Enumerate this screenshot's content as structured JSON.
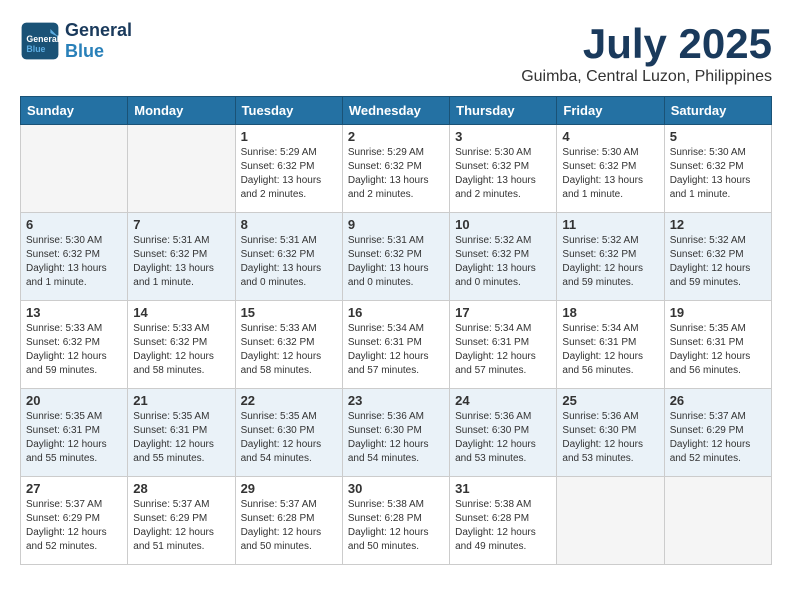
{
  "header": {
    "logo_line1": "General",
    "logo_line2": "Blue",
    "month_year": "July 2025",
    "location": "Guimba, Central Luzon, Philippines"
  },
  "weekdays": [
    "Sunday",
    "Monday",
    "Tuesday",
    "Wednesday",
    "Thursday",
    "Friday",
    "Saturday"
  ],
  "weeks": [
    [
      {
        "day": "",
        "info": ""
      },
      {
        "day": "",
        "info": ""
      },
      {
        "day": "1",
        "info": "Sunrise: 5:29 AM\nSunset: 6:32 PM\nDaylight: 13 hours\nand 2 minutes."
      },
      {
        "day": "2",
        "info": "Sunrise: 5:29 AM\nSunset: 6:32 PM\nDaylight: 13 hours\nand 2 minutes."
      },
      {
        "day": "3",
        "info": "Sunrise: 5:30 AM\nSunset: 6:32 PM\nDaylight: 13 hours\nand 2 minutes."
      },
      {
        "day": "4",
        "info": "Sunrise: 5:30 AM\nSunset: 6:32 PM\nDaylight: 13 hours\nand 1 minute."
      },
      {
        "day": "5",
        "info": "Sunrise: 5:30 AM\nSunset: 6:32 PM\nDaylight: 13 hours\nand 1 minute."
      }
    ],
    [
      {
        "day": "6",
        "info": "Sunrise: 5:30 AM\nSunset: 6:32 PM\nDaylight: 13 hours\nand 1 minute."
      },
      {
        "day": "7",
        "info": "Sunrise: 5:31 AM\nSunset: 6:32 PM\nDaylight: 13 hours\nand 1 minute."
      },
      {
        "day": "8",
        "info": "Sunrise: 5:31 AM\nSunset: 6:32 PM\nDaylight: 13 hours\nand 0 minutes."
      },
      {
        "day": "9",
        "info": "Sunrise: 5:31 AM\nSunset: 6:32 PM\nDaylight: 13 hours\nand 0 minutes."
      },
      {
        "day": "10",
        "info": "Sunrise: 5:32 AM\nSunset: 6:32 PM\nDaylight: 13 hours\nand 0 minutes."
      },
      {
        "day": "11",
        "info": "Sunrise: 5:32 AM\nSunset: 6:32 PM\nDaylight: 12 hours\nand 59 minutes."
      },
      {
        "day": "12",
        "info": "Sunrise: 5:32 AM\nSunset: 6:32 PM\nDaylight: 12 hours\nand 59 minutes."
      }
    ],
    [
      {
        "day": "13",
        "info": "Sunrise: 5:33 AM\nSunset: 6:32 PM\nDaylight: 12 hours\nand 59 minutes."
      },
      {
        "day": "14",
        "info": "Sunrise: 5:33 AM\nSunset: 6:32 PM\nDaylight: 12 hours\nand 58 minutes."
      },
      {
        "day": "15",
        "info": "Sunrise: 5:33 AM\nSunset: 6:32 PM\nDaylight: 12 hours\nand 58 minutes."
      },
      {
        "day": "16",
        "info": "Sunrise: 5:34 AM\nSunset: 6:31 PM\nDaylight: 12 hours\nand 57 minutes."
      },
      {
        "day": "17",
        "info": "Sunrise: 5:34 AM\nSunset: 6:31 PM\nDaylight: 12 hours\nand 57 minutes."
      },
      {
        "day": "18",
        "info": "Sunrise: 5:34 AM\nSunset: 6:31 PM\nDaylight: 12 hours\nand 56 minutes."
      },
      {
        "day": "19",
        "info": "Sunrise: 5:35 AM\nSunset: 6:31 PM\nDaylight: 12 hours\nand 56 minutes."
      }
    ],
    [
      {
        "day": "20",
        "info": "Sunrise: 5:35 AM\nSunset: 6:31 PM\nDaylight: 12 hours\nand 55 minutes."
      },
      {
        "day": "21",
        "info": "Sunrise: 5:35 AM\nSunset: 6:31 PM\nDaylight: 12 hours\nand 55 minutes."
      },
      {
        "day": "22",
        "info": "Sunrise: 5:35 AM\nSunset: 6:30 PM\nDaylight: 12 hours\nand 54 minutes."
      },
      {
        "day": "23",
        "info": "Sunrise: 5:36 AM\nSunset: 6:30 PM\nDaylight: 12 hours\nand 54 minutes."
      },
      {
        "day": "24",
        "info": "Sunrise: 5:36 AM\nSunset: 6:30 PM\nDaylight: 12 hours\nand 53 minutes."
      },
      {
        "day": "25",
        "info": "Sunrise: 5:36 AM\nSunset: 6:30 PM\nDaylight: 12 hours\nand 53 minutes."
      },
      {
        "day": "26",
        "info": "Sunrise: 5:37 AM\nSunset: 6:29 PM\nDaylight: 12 hours\nand 52 minutes."
      }
    ],
    [
      {
        "day": "27",
        "info": "Sunrise: 5:37 AM\nSunset: 6:29 PM\nDaylight: 12 hours\nand 52 minutes."
      },
      {
        "day": "28",
        "info": "Sunrise: 5:37 AM\nSunset: 6:29 PM\nDaylight: 12 hours\nand 51 minutes."
      },
      {
        "day": "29",
        "info": "Sunrise: 5:37 AM\nSunset: 6:28 PM\nDaylight: 12 hours\nand 50 minutes."
      },
      {
        "day": "30",
        "info": "Sunrise: 5:38 AM\nSunset: 6:28 PM\nDaylight: 12 hours\nand 50 minutes."
      },
      {
        "day": "31",
        "info": "Sunrise: 5:38 AM\nSunset: 6:28 PM\nDaylight: 12 hours\nand 49 minutes."
      },
      {
        "day": "",
        "info": ""
      },
      {
        "day": "",
        "info": ""
      }
    ]
  ]
}
